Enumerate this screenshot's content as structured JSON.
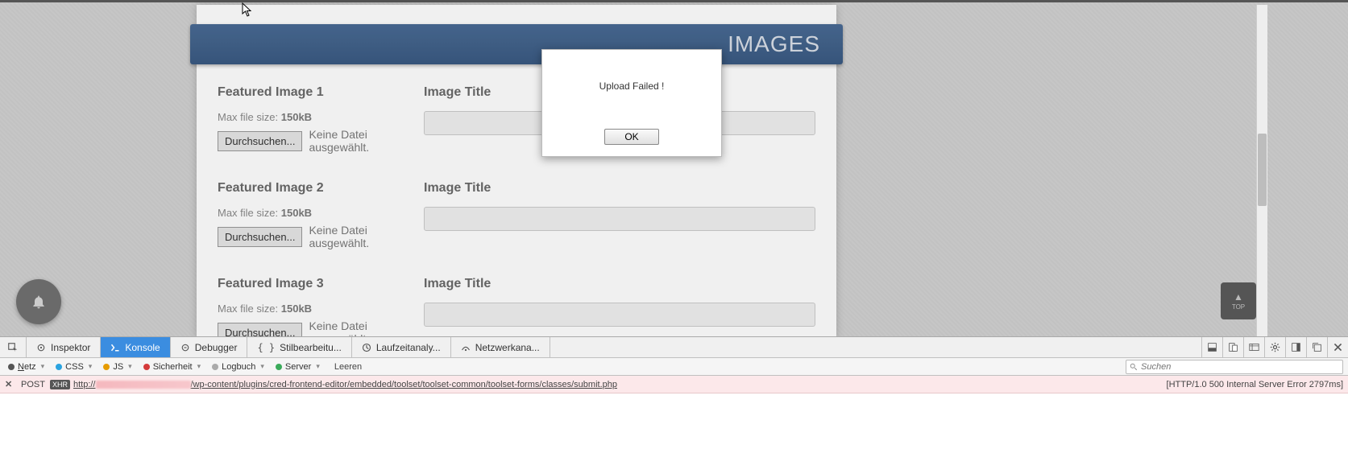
{
  "banner": {
    "title": "IMAGES"
  },
  "form": {
    "rows": [
      {
        "label": "Featured Image 1",
        "max_prefix": "Max file size: ",
        "max_value": "150kB",
        "browse": "Durchsuchen...",
        "file_status": "Keine Datei ausgewählt.",
        "title_label": "Image Title"
      },
      {
        "label": "Featured Image 2",
        "max_prefix": "Max file size: ",
        "max_value": "150kB",
        "browse": "Durchsuchen...",
        "file_status": "Keine Datei ausgewählt.",
        "title_label": "Image Title"
      },
      {
        "label": "Featured Image 3",
        "max_prefix": "Max file size: ",
        "max_value": "150kB",
        "browse": "Durchsuchen...",
        "file_status": "Keine Datei ausgewählt.",
        "title_label": "Image Title"
      }
    ]
  },
  "dialog": {
    "message": "Upload Failed !",
    "ok": "OK"
  },
  "back_to_top": {
    "label": "TOP"
  },
  "devtools": {
    "tabs": {
      "inspector": "Inspektor",
      "console": "Konsole",
      "debugger": "Debugger",
      "style": "Stilbearbeitu...",
      "perf": "Laufzeitanaly...",
      "network": "Netzwerkana..."
    },
    "filters": {
      "netz": "Netz",
      "css": "CSS",
      "js": "JS",
      "sicherheit": "Sicherheit",
      "logbuch": "Logbuch",
      "server": "Server",
      "leeren": "Leeren"
    },
    "search_placeholder": "Suchen",
    "log": {
      "method": "POST",
      "xhr": "XHR",
      "url_prefix": "http://",
      "url_suffix": "/wp-content/plugins/cred-frontend-editor/embedded/toolset/toolset-common/toolset-forms/classes/submit.php",
      "status": "[HTTP/1.0 500 Internal Server Error 2797ms]"
    }
  }
}
